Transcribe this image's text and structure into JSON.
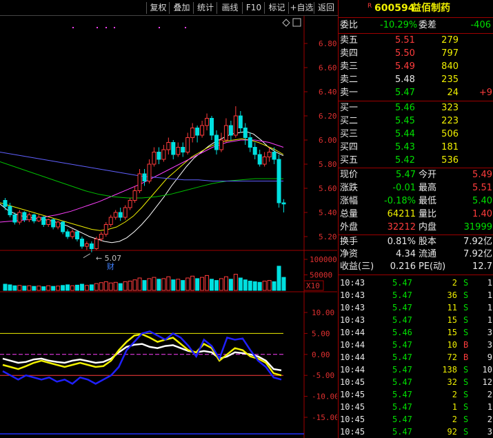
{
  "toolbar": {
    "buttons": [
      "复权",
      "叠加",
      "统计",
      "画线",
      "F10",
      "标记",
      "+自选",
      "返回"
    ]
  },
  "stock": {
    "badge": "R",
    "code": "600594",
    "name": "益佰制药"
  },
  "weibi": {
    "label1": "委比",
    "value1": "-10.29%",
    "label2": "委差",
    "value2": "-406"
  },
  "asks": [
    {
      "label": "卖五",
      "price": "5.51",
      "vol": "279",
      "chg": ""
    },
    {
      "label": "卖四",
      "price": "5.50",
      "vol": "797",
      "chg": ""
    },
    {
      "label": "卖三",
      "price": "5.49",
      "vol": "840",
      "chg": ""
    },
    {
      "label": "卖二",
      "price": "5.48",
      "vol": "235",
      "chg": ""
    },
    {
      "label": "卖一",
      "price": "5.47",
      "vol": "24",
      "chg": "+9"
    }
  ],
  "bids": [
    {
      "label": "买一",
      "price": "5.46",
      "vol": "323"
    },
    {
      "label": "买二",
      "price": "5.45",
      "vol": "223"
    },
    {
      "label": "买三",
      "price": "5.44",
      "vol": "506"
    },
    {
      "label": "买四",
      "price": "5.43",
      "vol": "181"
    },
    {
      "label": "买五",
      "price": "5.42",
      "vol": "536"
    }
  ],
  "stats": [
    {
      "l1": "现价",
      "v1": "5.47",
      "l2": "今开",
      "v2": "5.49"
    },
    {
      "l1": "涨跌",
      "v1": "-0.01",
      "l2": "最高",
      "v2": "5.51"
    },
    {
      "l1": "涨幅",
      "v1": "-0.18%",
      "l2": "最低",
      "v2": "5.40"
    },
    {
      "l1": "总量",
      "v1": "64211",
      "l2": "量比",
      "v2": "1.40"
    },
    {
      "l1": "外盘",
      "v1": "32212",
      "l2": "内盘",
      "v2": "31999"
    }
  ],
  "fundamentals": [
    {
      "l1": "换手",
      "v1": "0.81%",
      "l2": "股本",
      "v2": "7.92亿"
    },
    {
      "l1": "净资",
      "v1": "4.34",
      "l2": "流通",
      "v2": "7.92亿"
    },
    {
      "l1": "收益(三)",
      "v1": "0.216",
      "l2": "PE(动)",
      "v2": "12.7"
    }
  ],
  "ticks": [
    {
      "time": "10:43",
      "price": "5.47",
      "vol": "2",
      "side": "S",
      "n": "1"
    },
    {
      "time": "10:43",
      "price": "5.47",
      "vol": "36",
      "side": "S",
      "n": "1"
    },
    {
      "time": "10:43",
      "price": "5.47",
      "vol": "11",
      "side": "S",
      "n": "1"
    },
    {
      "time": "10:43",
      "price": "5.47",
      "vol": "15",
      "side": "S",
      "n": "1"
    },
    {
      "time": "10:44",
      "price": "5.46",
      "vol": "15",
      "side": "S",
      "n": "3"
    },
    {
      "time": "10:44",
      "price": "5.47",
      "vol": "10",
      "side": "B",
      "n": "3"
    },
    {
      "time": "10:44",
      "price": "5.47",
      "vol": "72",
      "side": "B",
      "n": "9"
    },
    {
      "time": "10:44",
      "price": "5.47",
      "vol": "138",
      "side": "S",
      "n": "10"
    },
    {
      "time": "10:45",
      "price": "5.47",
      "vol": "32",
      "side": "S",
      "n": "12"
    },
    {
      "time": "10:45",
      "price": "5.47",
      "vol": "2",
      "side": "S",
      "n": "2"
    },
    {
      "time": "10:45",
      "price": "5.47",
      "vol": "1",
      "side": "S",
      "n": "1"
    },
    {
      "time": "10:45",
      "price": "5.47",
      "vol": "2",
      "side": "S",
      "n": "2"
    },
    {
      "time": "10:45",
      "price": "5.47",
      "vol": "92",
      "side": "S",
      "n": "3"
    }
  ],
  "chart": {
    "price_ticks": [
      "6.80",
      "6.60",
      "6.40",
      "6.20",
      "6.00",
      "5.80",
      "5.60",
      "5.40",
      "5.20"
    ],
    "low_marker": "5.07",
    "event_marker": "财",
    "volume_ticks": [
      "100000",
      "50000"
    ],
    "volume_unit": "X10",
    "osc_ticks": [
      "10.00",
      "5.00",
      "0.00",
      "-5.00",
      "-10.00",
      "-15.00"
    ]
  },
  "chart_data": {
    "type": "candlestick",
    "price_axis": {
      "min": 5.07,
      "max": 6.88
    },
    "candles": [
      [
        5.5,
        5.45,
        5.52,
        5.42
      ],
      [
        5.45,
        5.38,
        5.48,
        5.36
      ],
      [
        5.38,
        5.32,
        5.4,
        5.3
      ],
      [
        5.32,
        5.4,
        5.42,
        5.3
      ],
      [
        5.4,
        5.34,
        5.41,
        5.32
      ],
      [
        5.34,
        5.38,
        5.4,
        5.32
      ],
      [
        5.38,
        5.33,
        5.39,
        5.31
      ],
      [
        5.33,
        5.36,
        5.38,
        5.32
      ],
      [
        5.36,
        5.3,
        5.37,
        5.28
      ],
      [
        5.3,
        5.34,
        5.35,
        5.28
      ],
      [
        5.34,
        5.28,
        5.35,
        5.26
      ],
      [
        5.28,
        5.32,
        5.33,
        5.26
      ],
      [
        5.32,
        5.24,
        5.33,
        5.22
      ],
      [
        5.24,
        5.2,
        5.26,
        5.18
      ],
      [
        5.2,
        5.24,
        5.26,
        5.18
      ],
      [
        5.24,
        5.18,
        5.25,
        5.16
      ],
      [
        5.18,
        5.12,
        5.2,
        5.1
      ],
      [
        5.12,
        5.14,
        5.16,
        5.09
      ],
      [
        5.14,
        5.1,
        5.16,
        5.07
      ],
      [
        5.1,
        5.18,
        5.2,
        5.09
      ],
      [
        5.18,
        5.22,
        5.24,
        5.16
      ],
      [
        5.22,
        5.3,
        5.32,
        5.2
      ],
      [
        5.3,
        5.36,
        5.38,
        5.28
      ],
      [
        5.36,
        5.4,
        5.42,
        5.34
      ],
      [
        5.4,
        5.36,
        5.44,
        5.33
      ],
      [
        5.36,
        5.44,
        5.46,
        5.34
      ],
      [
        5.44,
        5.5,
        5.52,
        5.42
      ],
      [
        5.5,
        5.58,
        5.62,
        5.48
      ],
      [
        5.58,
        5.72,
        5.76,
        5.56
      ],
      [
        5.72,
        5.66,
        5.76,
        5.62
      ],
      [
        5.66,
        5.8,
        5.84,
        5.64
      ],
      [
        5.8,
        5.9,
        5.94,
        5.78
      ],
      [
        5.9,
        5.84,
        5.94,
        5.8
      ],
      [
        5.84,
        5.92,
        5.96,
        5.82
      ],
      [
        5.92,
        5.98,
        6.02,
        5.88
      ],
      [
        5.98,
        5.88,
        6.0,
        5.84
      ],
      [
        5.88,
        5.94,
        5.98,
        5.86
      ],
      [
        5.94,
        5.9,
        5.98,
        5.86
      ],
      [
        5.9,
        6.02,
        6.06,
        5.88
      ],
      [
        6.02,
        6.1,
        6.14,
        5.98
      ],
      [
        6.1,
        6.04,
        6.12,
        5.98
      ],
      [
        6.04,
        6.12,
        6.16,
        6.02
      ],
      [
        6.12,
        6.18,
        6.22,
        6.08
      ],
      [
        6.18,
        6.04,
        6.2,
        6.0
      ],
      [
        6.04,
        5.92,
        6.08,
        5.88
      ],
      [
        5.92,
        6.0,
        6.06,
        5.9
      ],
      [
        6.0,
        6.12,
        6.18,
        5.98
      ],
      [
        6.12,
        6.04,
        6.16,
        6.0
      ],
      [
        6.04,
        6.2,
        6.28,
        6.02
      ],
      [
        6.2,
        6.1,
        6.24,
        6.06
      ],
      [
        6.1,
        6.02,
        6.14,
        5.96
      ],
      [
        6.02,
        5.94,
        6.06,
        5.9
      ],
      [
        5.94,
        5.88,
        5.98,
        5.84
      ],
      [
        5.88,
        5.8,
        5.92,
        5.78
      ],
      [
        5.8,
        5.86,
        5.9,
        5.78
      ],
      [
        5.86,
        5.9,
        5.94,
        5.82
      ],
      [
        5.9,
        5.84,
        5.94,
        5.8
      ],
      [
        5.84,
        5.48,
        5.88,
        5.44
      ],
      [
        5.48,
        5.47,
        5.51,
        5.4
      ]
    ],
    "ma_series": [
      {
        "color": "#ffffff",
        "values": [
          5.47,
          5.42,
          5.39,
          5.37,
          5.36,
          5.35,
          5.34,
          5.33,
          5.31,
          5.29,
          5.26,
          5.23,
          5.2,
          5.18,
          5.16,
          5.15,
          5.16,
          5.19,
          5.24,
          5.3,
          5.37,
          5.45,
          5.53,
          5.62,
          5.7,
          5.78,
          5.85,
          5.9,
          5.95,
          5.99,
          6.02,
          6.05,
          6.06,
          6.07,
          6.05,
          6.0,
          5.94,
          5.9,
          5.87
        ]
      },
      {
        "color": "#f0f000",
        "values": [
          5.48,
          5.46,
          5.44,
          5.42,
          5.4,
          5.38,
          5.36,
          5.34,
          5.32,
          5.3,
          5.28,
          5.26,
          5.25,
          5.26,
          5.28,
          5.32,
          5.37,
          5.44,
          5.52,
          5.6,
          5.68,
          5.74,
          5.8,
          5.86,
          5.9,
          5.94,
          5.97,
          5.99,
          6.0,
          6.01,
          6.0,
          5.98,
          5.95,
          5.92,
          5.88
        ]
      },
      {
        "color": "#ff40ff",
        "values": [
          5.32,
          5.33,
          5.34,
          5.36,
          5.38,
          5.41,
          5.45,
          5.49,
          5.54,
          5.59,
          5.64,
          5.7,
          5.76,
          5.82,
          5.88,
          5.94,
          5.98,
          6.0,
          6.0,
          5.98,
          5.94
        ]
      },
      {
        "color": "#00c000",
        "values": [
          5.82,
          5.78,
          5.74,
          5.7,
          5.66,
          5.62,
          5.58,
          5.55,
          5.53,
          5.52,
          5.52,
          5.53,
          5.55,
          5.58,
          5.61,
          5.64,
          5.66,
          5.67,
          5.68,
          5.68,
          5.68
        ]
      },
      {
        "color": "#6060ff",
        "values": [
          5.9,
          5.88,
          5.86,
          5.84,
          5.82,
          5.8,
          5.78,
          5.76,
          5.74,
          5.72,
          5.7,
          5.69,
          5.68,
          5.67,
          5.67,
          5.66,
          5.66,
          5.66,
          5.66,
          5.66,
          5.66
        ]
      }
    ],
    "volume": {
      "max": 120000,
      "values": [
        20000,
        18000,
        15000,
        16000,
        14000,
        15000,
        13000,
        14000,
        12000,
        15000,
        13000,
        14000,
        16000,
        18000,
        15000,
        17000,
        20000,
        16000,
        18000,
        22000,
        25000,
        28000,
        24000,
        26000,
        22000,
        28000,
        30000,
        34000,
        40000,
        32000,
        38000,
        42000,
        36000,
        38000,
        44000,
        34000,
        36000,
        32000,
        40000,
        46000,
        38000,
        42000,
        48000,
        36000,
        32000,
        38000,
        44000,
        36000,
        52000,
        40000,
        34000,
        30000,
        28000,
        26000,
        30000,
        32000,
        28000,
        78000,
        42000
      ]
    },
    "oscillator": {
      "range": [
        -19,
        14
      ],
      "series": [
        {
          "color": "#ffffff",
          "values": [
            -1,
            -1.5,
            -2,
            -1.8,
            -1.2,
            -1,
            -1.5,
            -1.8,
            -2,
            -1.5,
            -1.2,
            -1.6,
            -2,
            -1.8,
            -1,
            0.5,
            1.8,
            2.3,
            2.5,
            1.8,
            1.5,
            2,
            2.2,
            1.5,
            0.8,
            0.5,
            0.8,
            0.5,
            -1,
            -0.5,
            0.5,
            0.3,
            0,
            -0.5,
            -1.5,
            -3.5,
            -3.8
          ]
        },
        {
          "color": "#f0f000",
          "values": [
            -2.5,
            -3,
            -3.5,
            -2.8,
            -2,
            -1.5,
            -2,
            -2.5,
            -3,
            -2.5,
            -2,
            -2.5,
            -3,
            -2.8,
            -1.5,
            1,
            3,
            4.5,
            4.8,
            4,
            3,
            3.5,
            4,
            2.5,
            1,
            0.5,
            2.5,
            1.5,
            -1.5,
            0,
            1.5,
            1,
            -0.5,
            -1,
            -2,
            -4.5,
            -5
          ]
        },
        {
          "color": "#2020ff",
          "values": [
            -4,
            -5,
            -6,
            -5,
            -5.5,
            -6,
            -5.5,
            -6.5,
            -6,
            -7,
            -5.5,
            -6,
            -7,
            -6,
            -5,
            -3,
            1,
            3,
            5,
            5.5,
            4.5,
            3.5,
            5,
            4,
            2,
            -0.5,
            3.5,
            2,
            -1,
            4,
            3.5,
            3.8,
            1,
            -1.5,
            -3,
            -5.5,
            -6
          ]
        }
      ],
      "guides": [
        5,
        0,
        -5
      ]
    }
  }
}
